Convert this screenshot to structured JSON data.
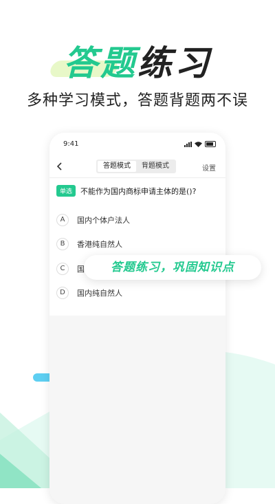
{
  "hero": {
    "title_green": "答题",
    "title_dark": "练习",
    "subtitle": "多种学习模式，答题背题两不误"
  },
  "colors": {
    "accent": "#23c98f",
    "mint": "#e6faf3",
    "cyan": "#5ecff2"
  },
  "phone": {
    "status": {
      "time": "9:41"
    },
    "nav": {
      "tabs": [
        {
          "label": "答题模式",
          "active": true
        },
        {
          "label": "背题模式",
          "active": false
        }
      ],
      "settings_label": "设置"
    },
    "question": {
      "tag": "单选",
      "text": "不能作为国内商标申请主体的是()?"
    },
    "options": [
      {
        "letter": "A",
        "text": "国内个体户法人"
      },
      {
        "letter": "B",
        "text": "香港纯自然人"
      },
      {
        "letter": "C",
        "text": "国"
      },
      {
        "letter": "D",
        "text": "国内纯自然人"
      }
    ]
  },
  "banner": {
    "text": "答题练习，巩固知识点"
  }
}
